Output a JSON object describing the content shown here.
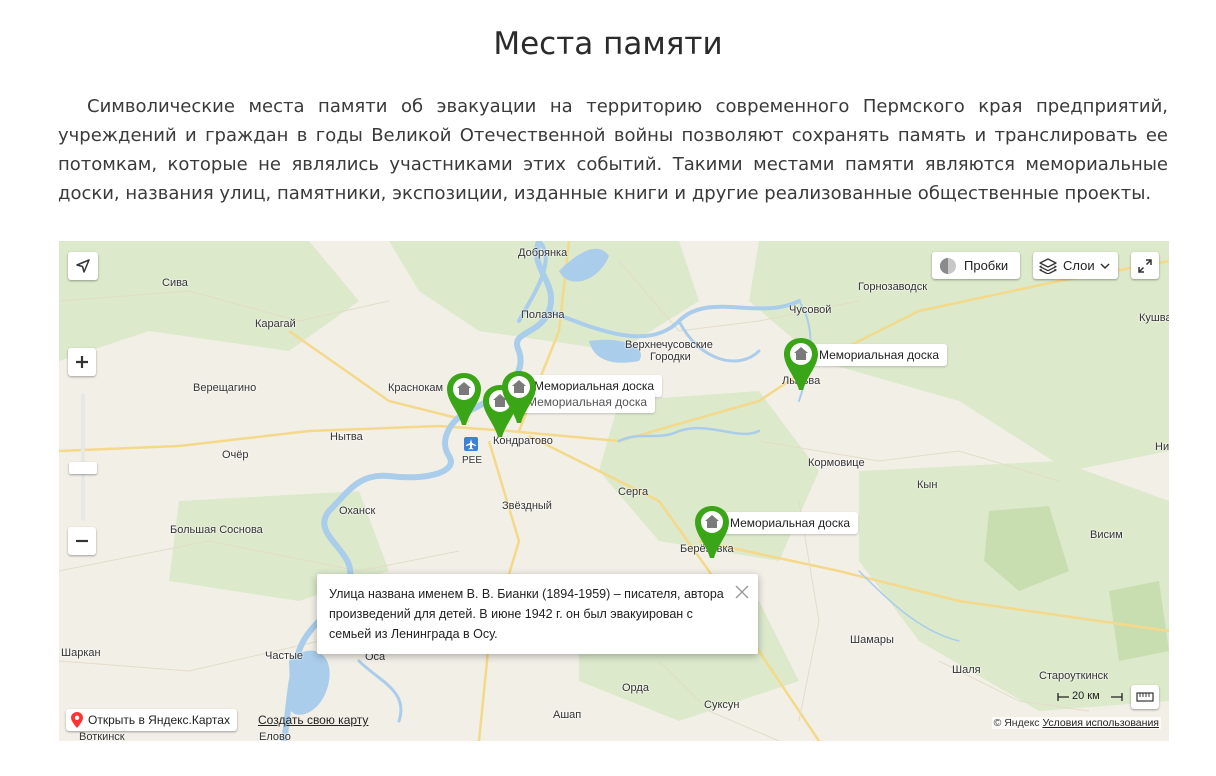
{
  "page": {
    "title": "Места памяти",
    "intro": "Символические места памяти об эвакуации на территорию современного Пермского края предприятий, учреждений и граждан в годы Великой Отечественной войны позволяют сохранять память и транслировать ее потомкам, которые не являлись участниками этих событий. Такими местами памяти являются мемориальные доски, названия улиц, памятники, экспозиции, изданные книги и другие реализованные общественные проекты."
  },
  "map": {
    "controls": {
      "traffic_label": "Пробки",
      "layers_label": "Слои",
      "open_label": "Открыть в Яндекс.Картах",
      "create_label": "Создать свою карту",
      "scale_label": "20 км",
      "copyright_brand": "© Яндекс",
      "terms_label": "Условия использования"
    },
    "places": [
      "Добрянка",
      "Сива",
      "Полазна",
      "Горнозаводск",
      "Чусовой",
      "Кушва",
      "Карагай",
      "Верхнечусовские",
      "Городки",
      "Верещагино",
      "Краснокам",
      "Лысьва",
      "Нытва",
      "Кондратово",
      "PEE",
      "Очёр",
      "Кормовице",
      "Ни",
      "Серга",
      "Кын",
      "Оханск",
      "Звёздный",
      "Большая Соснова",
      "Берёзовка",
      "Висим",
      "Шамары",
      "Шаркан",
      "Частые",
      "Оса",
      "Шаля",
      "Староуткинск",
      "Орда",
      "Ашап",
      "Суксун",
      "Воткинск",
      "Елово"
    ],
    "markers": [
      {
        "label": "Мемориальная доска"
      },
      {
        "label": "Мемориальная доска"
      },
      {
        "label": "Мемориальная доска"
      },
      {
        "label": "Мемориальная доска"
      }
    ],
    "balloon": {
      "text": "Улица названа именем В. В. Бианки (1894-1959) – писателя, автора произведений для детей. В июне 1942 г. он был эвакуирован с семьей из Ленинграда в Осу."
    },
    "colors": {
      "water": "#a9cdeb",
      "forest": "#d6e6c3",
      "land": "#f2efe7",
      "marker_green": "#3aa516"
    }
  }
}
